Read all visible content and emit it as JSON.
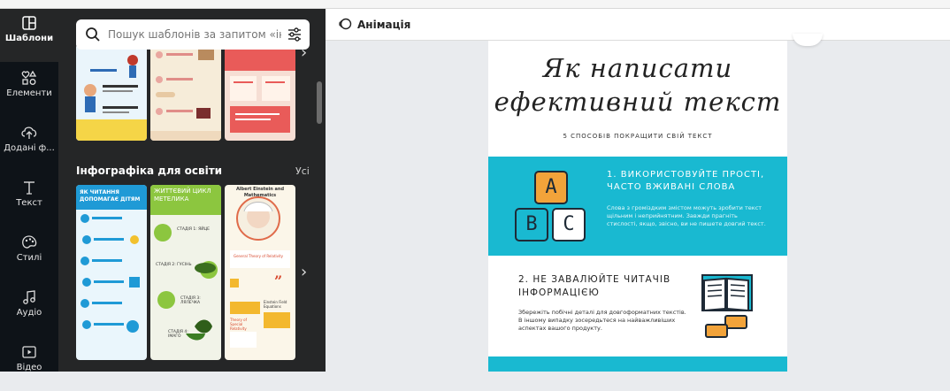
{
  "sidebar": {
    "items": [
      {
        "label": "Шаблони",
        "icon": "templates-icon",
        "active": true
      },
      {
        "label": "Елементи",
        "icon": "elements-icon"
      },
      {
        "label": "Додані ф...",
        "icon": "upload-icon"
      },
      {
        "label": "Текст",
        "icon": "text-icon"
      },
      {
        "label": "Стилі",
        "icon": "palette-icon"
      },
      {
        "label": "Аудіо",
        "icon": "music-icon"
      },
      {
        "label": "Відео",
        "icon": "video-icon"
      }
    ]
  },
  "search": {
    "placeholder": "Пошук шаблонів за запитом «інф"
  },
  "section": {
    "title": "Інфографіка для освіти",
    "see_all": "Усі"
  },
  "templates": {
    "t1": {
      "title": "ЯК ЧИТАННЯ ДОПОМАГАЄ ДІТЯМ"
    },
    "t2": {
      "title": "ЖИТТЄВИЙ ЦИКЛ МЕТЕЛИКА",
      "stage1": "СТАДІЯ 1: ЯЙЦЕ",
      "stage2": "СТАДІЯ 2: ГУСІНЬ",
      "stage3": "СТАДІЯ 3: ЛЯЛЕЧКА",
      "stage4": "СТАДІЯ 4: ІМАГО"
    },
    "t3": {
      "title": "Albert Einstein and Mathematics",
      "text1": "General Theory of Relativity",
      "text2": "Theory of Special Relativity",
      "text3": "Einstein Field Equations"
    }
  },
  "toolbar": {
    "animation_label": "Анімація"
  },
  "design": {
    "title_line1": "Як написати",
    "title_line2": "ефективний текст",
    "subtitle": "5 СПОСОБІВ ПОКРАЩИТИ СВІЙ ТЕКСТ",
    "point1_title": "1. ВИКОРИСТОВУЙТЕ ПРОСТІ, ЧАСТО ВЖИВАНІ СЛОВА",
    "point1_body": "Слова з громіздким змістом можуть зробити текст щільним і неприйнятним. Завжди прагніть стислості, якщо, звісно, ви не пишете довгий текст.",
    "point2_title": "2. НЕ ЗАВАЛЮЙТЕ ЧИТАЧІВ ІНФОРМАЦІЄЮ",
    "point2_body": "Збережіть побічні деталі для довгоформатних текстів. В іншому випадку зосередьтеся на найважливіших аспектах вашого продукту.",
    "tiles": [
      "A",
      "B",
      "C"
    ]
  },
  "colors": {
    "accent": "#19b9d1",
    "rail": "#0e1318",
    "panel": "#252627"
  }
}
